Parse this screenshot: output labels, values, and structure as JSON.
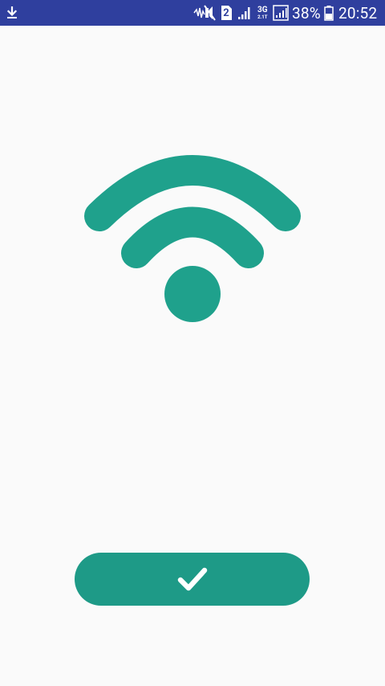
{
  "status_bar": {
    "background_color": "#2f3f9e",
    "icons": [
      "download-icon",
      "mute-icon",
      "sim-2-icon",
      "signal-icon",
      "network-3g-icon",
      "signal-icon",
      "battery-icon"
    ],
    "sim_label": "2",
    "network_label": "3G",
    "network_sub_label": "2.1T",
    "battery_percent": "38%",
    "time": "20:52"
  },
  "main": {
    "graphic_icon": "wifi-icon",
    "accent_color": "#1fa18c"
  },
  "confirm_button": {
    "icon": "checkmark-icon",
    "color": "#1e9a87"
  }
}
